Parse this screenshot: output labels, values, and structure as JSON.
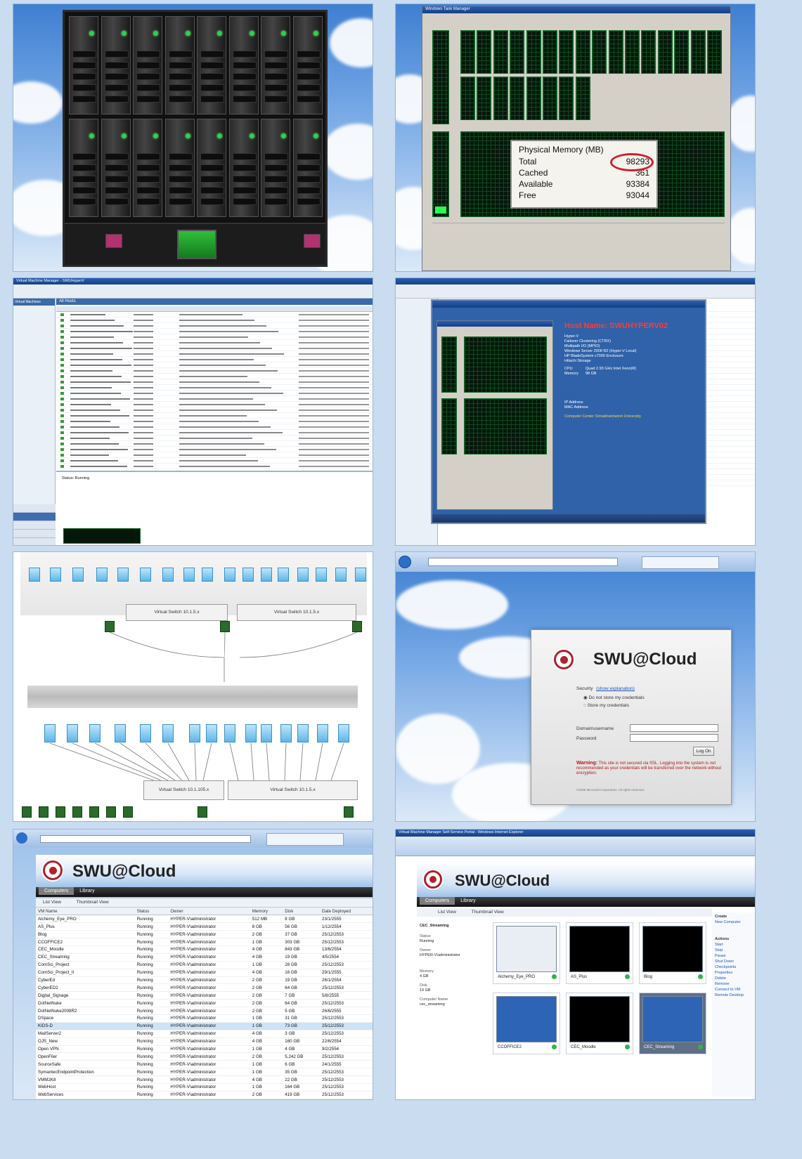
{
  "memory_panel": {
    "title": "Physical Memory (MB)",
    "rows": [
      {
        "label": "Total",
        "value": "98293"
      },
      {
        "label": "Cached",
        "value": "361"
      },
      {
        "label": "Available",
        "value": "93384"
      },
      {
        "label": "Free",
        "value": "93044"
      }
    ],
    "highlight_color": "#d0202a"
  },
  "host_info": {
    "heading": "Host Name: SWUHYPERV02",
    "lines": [
      "Hyper-V",
      "Failover Clustering (CTRX)",
      "Multipath I/O (MPIO)",
      "Windows Server 2008 R2 (Hyper-V Local)",
      "HP BladeSystem c7000 Enclosure",
      "Hitachi Storage"
    ],
    "cpu_label": "CPU",
    "cpu_value": "Quad 2.93 GHz Intel Xeon(R)",
    "memory_label": "Memory",
    "memory_value": "98 GB",
    "ip_label": "IP Address",
    "mac_label": "MAC Address",
    "footer": "Computer Center Srinakharinwirot University"
  },
  "vmm_admin": {
    "title": "Virtual Machine Manager - SWUHyperV",
    "section": "All Hosts",
    "status_label": "Status",
    "status_value": "Running"
  },
  "network": {
    "switch_top_left": "Virtual Switch 10.1.5.x",
    "switch_top_right": "Virtual Switch 10.1.5.x",
    "switch_bottom_left": "Virtual Switch 10.1.105.x",
    "switch_bottom_right": "Virtual Switch 10.1.5.x"
  },
  "login": {
    "brand": "SWU@Cloud",
    "security_label": "Security",
    "show_explanation": "(show explanation)",
    "opt_no_store": "Do not store my credentials",
    "opt_store": "Store my credentials",
    "domain_label": "Domain\\username",
    "password_label": "Password",
    "login_button": "Log On",
    "warning_title": "Warning:",
    "warning_text": "This site is not secured via SSL. Logging into the system is not recommended as your credentials will be transferred over the network without encryption.",
    "copyright": "©2008 Microsoft Corporation. All rights reserved."
  },
  "portal_list": {
    "brand": "SWU@Cloud",
    "tab_computers": "Computers",
    "tab_library": "Library",
    "view_list": "List View",
    "view_thumb": "Thumbnail View",
    "columns": [
      "VM Name",
      "Status",
      "Owner",
      "Memory",
      "Disk",
      "Date Deployed"
    ],
    "rows": [
      [
        "Alchemy_Eye_PRO",
        "Running",
        "HYPER-V\\administrator",
        "512 MB",
        "8 GB",
        "23/1/2555"
      ],
      [
        "AS_Plus",
        "Running",
        "HYPER-V\\administrator",
        "8 GB",
        "56 GB",
        "1/12/2554"
      ],
      [
        "Blog",
        "Running",
        "HYPER-V\\administrator",
        "2 GB",
        "37 GB",
        "25/12/2553"
      ],
      [
        "CCOFFICE2",
        "Running",
        "HYPER-V\\administrator",
        "1 GB",
        "303 GB",
        "25/12/2553"
      ],
      [
        "CEC_Moodle",
        "Running",
        "HYPER-V\\administrator",
        "4 GB",
        "843 GB",
        "13/6/2554"
      ],
      [
        "CEC_Streaming",
        "Running",
        "HYPER-V\\administrator",
        "4 GB",
        "19 GB",
        "4/5/2554"
      ],
      [
        "ComSci_Project",
        "Running",
        "HYPER-V\\administrator",
        "1 GB",
        "28 GB",
        "25/12/2553"
      ],
      [
        "ComSci_Project_II",
        "Running",
        "HYPER-V\\administrator",
        "4 GB",
        "16 GB",
        "29/1/2555"
      ],
      [
        "CyberEd",
        "Running",
        "HYPER-V\\administrator",
        "2 GB",
        "19 GB",
        "26/1/2554"
      ],
      [
        "CyberED2",
        "Running",
        "HYPER-V\\administrator",
        "2 GB",
        "64 GB",
        "25/12/2553"
      ],
      [
        "Digital_Signage",
        "Running",
        "HYPER-V\\administrator",
        "2 GB",
        "7 GB",
        "5/8/2555"
      ],
      [
        "DotNetNuke",
        "Running",
        "HYPER-V\\administrator",
        "2 GB",
        "64 GB",
        "25/12/2553"
      ],
      [
        "DotNetNuke2008R2",
        "Running",
        "HYPER-V\\administrator",
        "2 GB",
        "5 GB",
        "26/6/2555"
      ],
      [
        "DSpace",
        "Running",
        "HYPER-V\\administrator",
        "1 GB",
        "31 GB",
        "25/12/2553"
      ],
      [
        "KIDS-D",
        "Running",
        "HYPER-V\\administrator",
        "1 GB",
        "73 GB",
        "25/12/2553"
      ],
      [
        "MailServer2",
        "Running",
        "HYPER-V\\administrator",
        "4 GB",
        "3 GB",
        "25/12/2553"
      ],
      [
        "OJS_New",
        "Running",
        "HYPER-V\\administrator",
        "4 GB",
        "160 GB",
        "22/6/2554"
      ],
      [
        "Open VPN",
        "Running",
        "HYPER-V\\administrator",
        "1 GB",
        "4 GB",
        "9/2/2554"
      ],
      [
        "OpenFiler",
        "Running",
        "HYPER-V\\administrator",
        "2 GB",
        "5,242 GB",
        "25/12/2553"
      ],
      [
        "SourceSafe",
        "Running",
        "HYPER-V\\administrator",
        "1 GB",
        "6 GB",
        "24/1/2555"
      ],
      [
        "SymantecEndpointProtection",
        "Running",
        "HYPER-V\\administrator",
        "1 GB",
        "35 GB",
        "25/12/2553"
      ],
      [
        "VMM2K8",
        "Running",
        "HYPER-V\\administrator",
        "4 GB",
        "22 GB",
        "25/12/2553"
      ],
      [
        "WebHost",
        "Running",
        "HYPER-V\\administrator",
        "1 GB",
        "164 GB",
        "25/12/2553"
      ],
      [
        "WebServices",
        "Running",
        "HYPER-V\\administrator",
        "2 GB",
        "419 GB",
        "25/12/2553"
      ]
    ]
  },
  "portal_thumbs": {
    "window_title": "Virtual Machine Manager Self-Service Portal - Windows Internet Explorer",
    "brand": "SWU@Cloud",
    "tab_computers": "Computers",
    "tab_library": "Library",
    "view_list": "List View",
    "view_thumb": "Thumbnail View",
    "selected_vm": "CEC_Streaming",
    "detail_status_label": "Status",
    "detail_status": "Running",
    "detail_owner_label": "Owner",
    "detail_owner": "HYPER-V\\administrator",
    "detail_memory_label": "Memory",
    "detail_memory": "4 GB",
    "detail_disk_label": "Disk",
    "detail_disk": "19 GB",
    "detail_computer_label": "Computer Name",
    "detail_computer": "cec_streaming",
    "thumbs": [
      "Alchemy_Eye_PRO",
      "AS_Plus",
      "Blog",
      "CCOFFICE2",
      "CEC_Moodle",
      "CEC_Streaming"
    ],
    "actions_create": "Create",
    "actions_new": "New Computer",
    "actions_title": "Actions",
    "actions": [
      "Start",
      "Stop",
      "Pause",
      "Shut Down",
      "Checkpoints",
      "Properties",
      "Delete",
      "Remove",
      "Connect to VM",
      "Remote Desktop"
    ]
  }
}
